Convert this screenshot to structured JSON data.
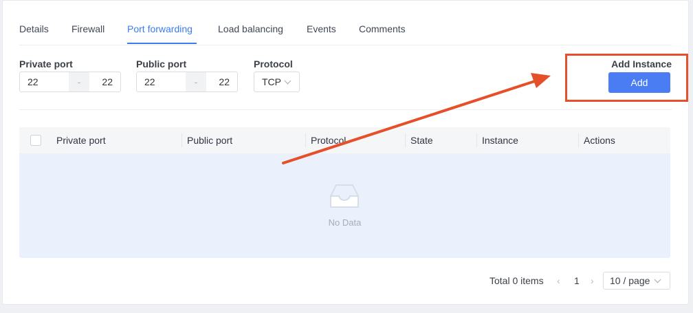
{
  "tabs": [
    {
      "label": "Details"
    },
    {
      "label": "Firewall"
    },
    {
      "label": "Port forwarding",
      "active": true
    },
    {
      "label": "Load balancing"
    },
    {
      "label": "Events"
    },
    {
      "label": "Comments"
    }
  ],
  "filters": {
    "private_port": {
      "label": "Private port",
      "from": "22",
      "separator": "-",
      "to": "22"
    },
    "public_port": {
      "label": "Public port",
      "from": "22",
      "separator": "-",
      "to": "22"
    },
    "protocol": {
      "label": "Protocol",
      "value": "TCP"
    }
  },
  "add_instance": {
    "label": "Add Instance",
    "button": "Add"
  },
  "table": {
    "columns": [
      "Private port",
      "Public port",
      "Protocol",
      "State",
      "Instance",
      "Actions"
    ],
    "rows": [],
    "empty_text": "No Data"
  },
  "pagination": {
    "total": "Total 0 items",
    "current_page": "1",
    "page_size": "10 / page"
  },
  "colors": {
    "accent": "#3a7bf3",
    "button": "#4a7df4",
    "annotation": "#e5502a",
    "empty_bg": "#eaf1fc"
  }
}
